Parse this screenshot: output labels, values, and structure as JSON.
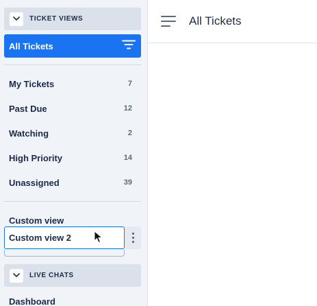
{
  "sidebar": {
    "ticket_views_header": "TICKET VIEWS",
    "active_view": "All Tickets",
    "views": [
      {
        "label": "My Tickets",
        "count": "7"
      },
      {
        "label": "Past Due",
        "count": "12"
      },
      {
        "label": "Watching",
        "count": "2"
      },
      {
        "label": "High Priority",
        "count": "14"
      },
      {
        "label": "Unassigned",
        "count": "39"
      }
    ],
    "custom_view": "Custom view",
    "custom_view_rename": "Custom view 2",
    "live_chats_header": "LIVE CHATS",
    "dashboard_label": "Dashboard"
  },
  "main": {
    "title": "All Tickets"
  },
  "colors": {
    "accent": "#1a73f0",
    "sidebar_bg": "#f0f3f8",
    "text": "#1c2b4a"
  },
  "icons": [
    "chevron-down-icon",
    "filter-icon",
    "kebab-icon",
    "hamburger-icon",
    "mouse-cursor-icon"
  ]
}
